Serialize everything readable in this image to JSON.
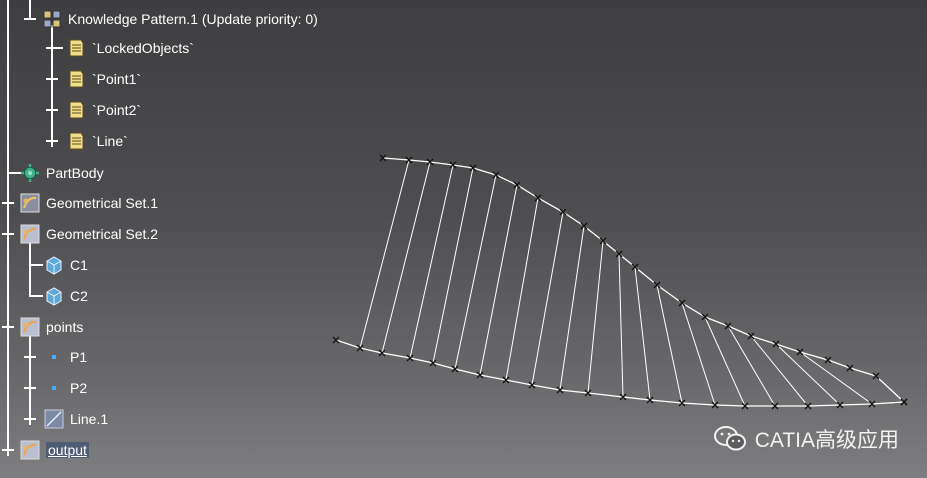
{
  "tree": {
    "items": [
      {
        "label": "Knowledge Pattern.1 (Update priority: 0)",
        "icon": "knowledge-pattern-icon"
      },
      {
        "label": "`LockedObjects`",
        "icon": "document-list-icon"
      },
      {
        "label": "`Point1`",
        "icon": "document-list-icon"
      },
      {
        "label": "`Point2`",
        "icon": "document-list-icon"
      },
      {
        "label": "`Line`",
        "icon": "document-list-icon"
      },
      {
        "label": "PartBody",
        "icon": "gear-icon"
      },
      {
        "label": "Geometrical Set.1",
        "icon": "geometrical-set-icon"
      },
      {
        "label": "Geometrical Set.2",
        "icon": "geometrical-set-icon"
      },
      {
        "label": "C1",
        "icon": "cube-icon"
      },
      {
        "label": "C2",
        "icon": "cube-icon"
      },
      {
        "label": "points",
        "icon": "geometrical-set-icon"
      },
      {
        "label": "P1",
        "icon": "point-icon"
      },
      {
        "label": "P2",
        "icon": "point-icon"
      },
      {
        "label": "Line.1",
        "icon": "line-icon"
      },
      {
        "label": "output",
        "icon": "geometrical-set-icon"
      }
    ]
  },
  "watermark": {
    "text": "CATIA高级应用",
    "icon": "wechat-icon"
  },
  "colors": {
    "tree_text": "#ffffff",
    "curve": "#ffffff",
    "background_top": "#3e3e40",
    "background_bottom": "#7e7e80"
  }
}
